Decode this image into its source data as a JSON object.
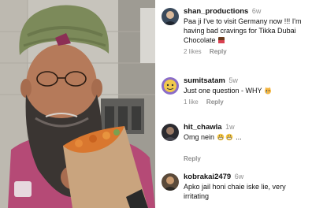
{
  "comments": [
    {
      "username": "shan_productions",
      "time": "6w",
      "text": "Paa ji I've to visit Germany now !!! I'm having bad cravings for Tikka Dubai Chocolate",
      "emoji": "chocolate-emoji",
      "likes": "2 likes",
      "reply": "Reply"
    },
    {
      "username": "sumitsatam",
      "time": "5w",
      "text": "Just one question - WHY",
      "emoji": "crying-cat-emoji",
      "likes": "1 like",
      "reply": "Reply"
    },
    {
      "username": "hit_chawla",
      "time": "1w",
      "text": "Omg nein",
      "emoji": "grimace-emoji-x2",
      "suffix": "...",
      "reply": "Reply"
    },
    {
      "username": "kobrakai2479",
      "time": "6w",
      "text": "Apko jail honi chaie iske lie, very irritating"
    }
  ]
}
